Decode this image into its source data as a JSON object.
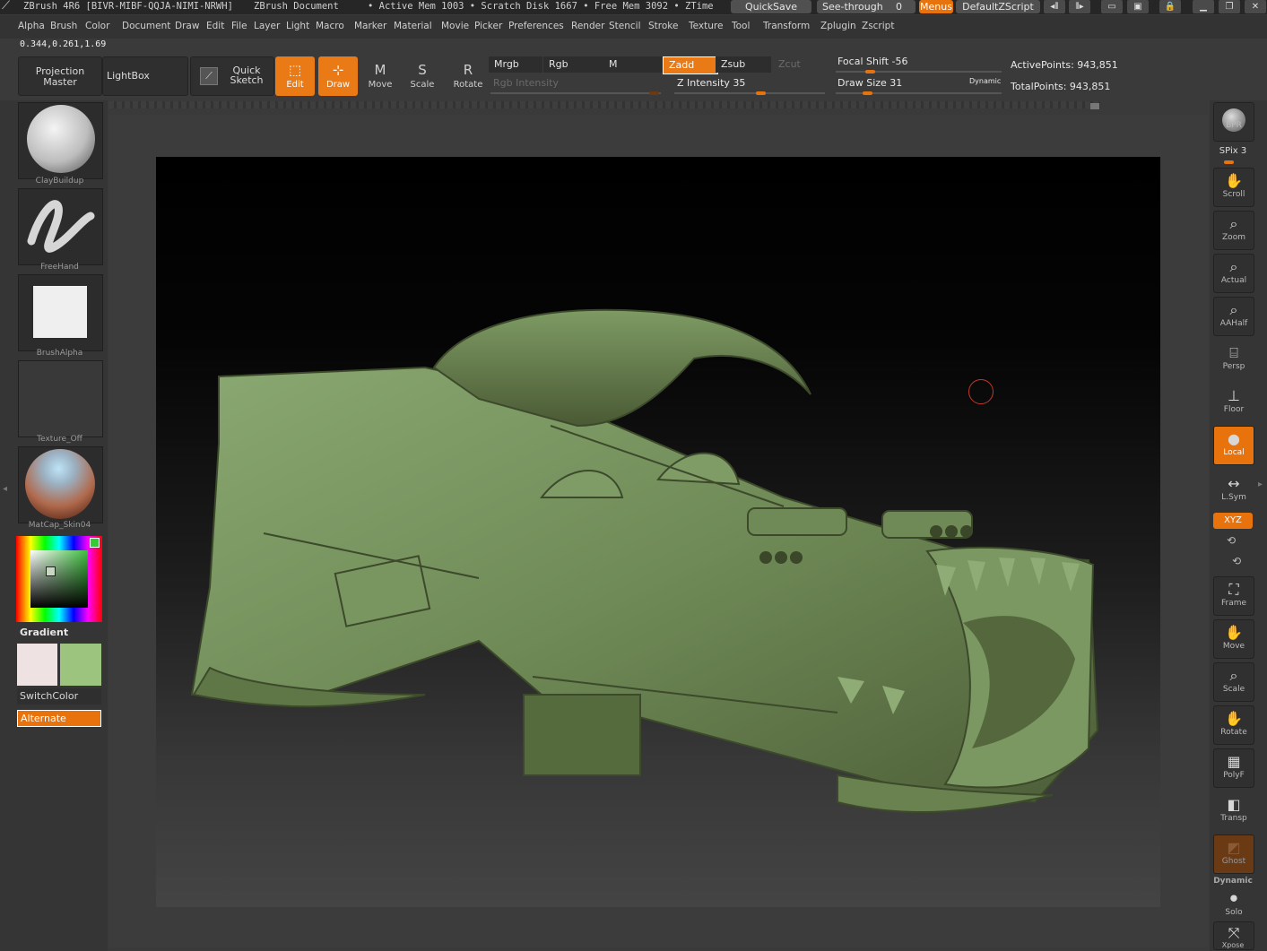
{
  "title_bar": {
    "app_title": "ZBrush 4R6 [BIVR-MIBF-QQJA-NIMI-NRWH]",
    "document": "ZBrush Document",
    "status": "• Active Mem 1003 • Scratch Disk 1667 • Free Mem 3092 • ZTime",
    "quicksave": "QuickSave",
    "see_through": "See-through",
    "see_through_value": "0",
    "menus": "Menus",
    "script": "DefaultZScript"
  },
  "menu_bar": [
    "Alpha",
    "Brush",
    "Color",
    "Document",
    "Draw",
    "Edit",
    "File",
    "Layer",
    "Light",
    "Macro",
    "Marker",
    "Material",
    "Movie",
    "Picker",
    "Preferences",
    "Render",
    "Stencil",
    "Stroke",
    "Texture",
    "Tool",
    "Transform",
    "Zplugin",
    "Zscript"
  ],
  "coords": "0.344,0.261,1.69",
  "shelf": {
    "projection_master": "Projection Master",
    "lightbox": "LightBox",
    "quick_sketch": "Quick Sketch",
    "tools": [
      {
        "label": "Edit",
        "active": true
      },
      {
        "label": "Draw",
        "active": true
      },
      {
        "label": "Move",
        "active": false
      },
      {
        "label": "Scale",
        "active": false
      },
      {
        "label": "Rotate",
        "active": false
      }
    ],
    "mrgb": "Mrgb",
    "rgb": "Rgb",
    "m": "M",
    "zadd": "Zadd",
    "zsub": "Zsub",
    "zcut": "Zcut",
    "rgb_intensity": "Rgb Intensity",
    "z_intensity": "Z Intensity 35",
    "focal_shift": "Focal Shift -56",
    "draw_size": "Draw Size 31",
    "dynamic": "Dynamic",
    "active_points": "ActivePoints: 943,851",
    "total_points": "TotalPoints: 943,851"
  },
  "left_tray": {
    "brush": "ClayBuildup",
    "stroke": "FreeHand",
    "alpha": "BrushAlpha",
    "texture": "Texture_Off",
    "material": "MatCap_Skin04",
    "gradient": "Gradient",
    "switch_color": "SwitchColor",
    "alternate": "Alternate",
    "colors": {
      "main": "#efe2e3",
      "secondary": "#9dc47e",
      "accent": "#e8720c"
    }
  },
  "right_tray": {
    "bpr": "BPR",
    "spix": "SPix 3",
    "scroll": "Scroll",
    "zoom": "Zoom",
    "actual": "Actual",
    "aahalf": "AAHalf",
    "persp": "Persp",
    "floor": "Floor",
    "local": "Local",
    "lsym": "L.Sym",
    "xyz": "XYZ",
    "frame": "Frame",
    "move": "Move",
    "scale": "Scale",
    "rotate": "Rotate",
    "polyf": "PolyF",
    "transp": "Transp",
    "ghost": "Ghost",
    "dynamic": "Dynamic",
    "solo": "Solo",
    "xpose": "Xpose"
  },
  "icons": [
    "zbrush-logo-icon",
    "move-tool-icon",
    "scale-tool-icon",
    "rotate-tool-icon",
    "edit-tool-icon",
    "draw-tool-icon",
    "hand-scroll-icon",
    "zoom-icon",
    "persp-icon",
    "floor-icon",
    "local-icon",
    "sym-icon",
    "frame-icon",
    "polyframe-icon",
    "brush-cursor-icon"
  ]
}
